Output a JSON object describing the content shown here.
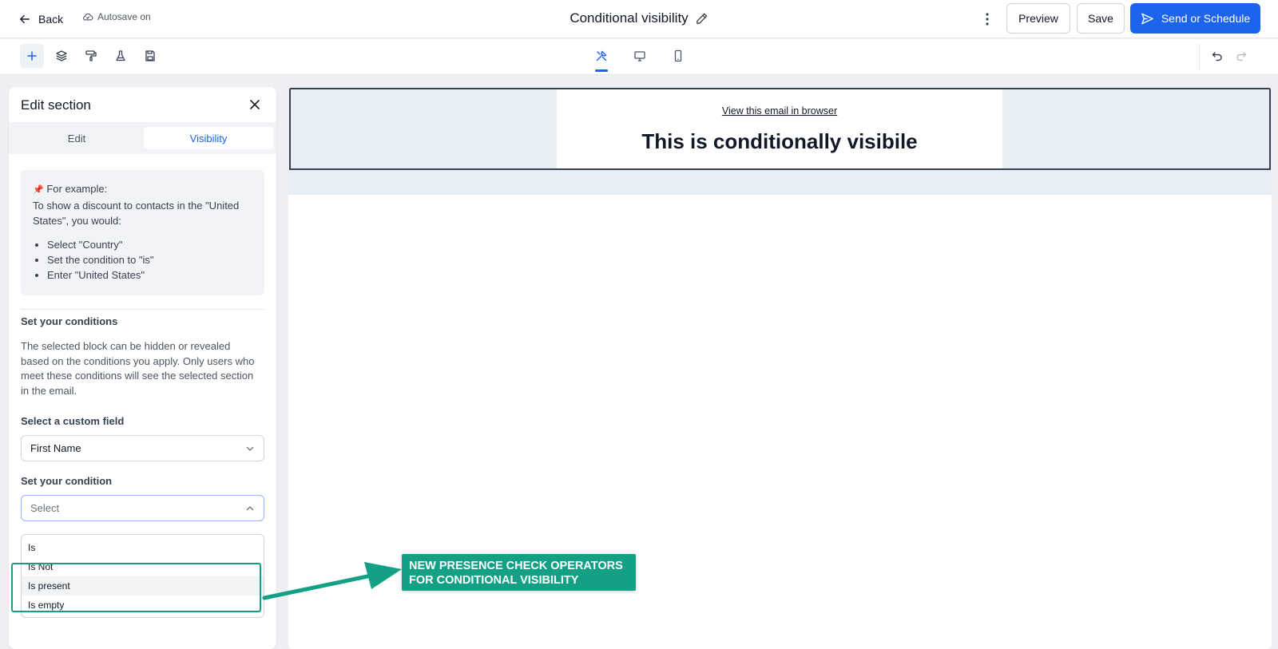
{
  "header": {
    "back_label": "Back",
    "autosave_label": "Autosave on",
    "title": "Conditional visibility",
    "preview_label": "Preview",
    "save_label": "Save",
    "send_label": "Send or Schedule"
  },
  "colors": {
    "primary": "#1d63ed",
    "annotation": "#14a085",
    "canvas_bg": "#e8eef6"
  },
  "toolbar": {
    "left_tools": [
      "plus-icon",
      "layers-icon",
      "paint-roller-icon",
      "flask-icon",
      "save-icon"
    ],
    "view_tools": [
      "design-tools-icon",
      "desktop-icon",
      "mobile-icon"
    ],
    "right_tools": [
      "undo-icon",
      "redo-icon"
    ]
  },
  "panel": {
    "title": "Edit section",
    "tabs": {
      "edit": "Edit",
      "visibility": "Visibility"
    },
    "example": {
      "pin": "📌",
      "heading": "For example:",
      "intro": "To show a discount to contacts in the \"United States\", you would:",
      "steps": [
        "Select \"Country\"",
        "Set the condition to \"is\"",
        "Enter \"United States\""
      ]
    },
    "conditions_heading": "Set your conditions",
    "conditions_desc": "The selected block can be hidden or revealed based on the conditions you apply. Only users who meet these conditions will see the selected section in the email.",
    "custom_field_label": "Select a custom field",
    "custom_field_value": "First Name",
    "condition_label": "Set your condition",
    "condition_placeholder": "Select",
    "condition_options": [
      "Is",
      "Is Not",
      "Is present",
      "Is empty"
    ]
  },
  "canvas": {
    "view_link": "View this email in browser",
    "headline": "This is conditionally visibile"
  },
  "annotation": {
    "line1": "NEW PRESENCE CHECK OPERATORS",
    "line2": "FOR CONDITIONAL VISIBILITY"
  }
}
